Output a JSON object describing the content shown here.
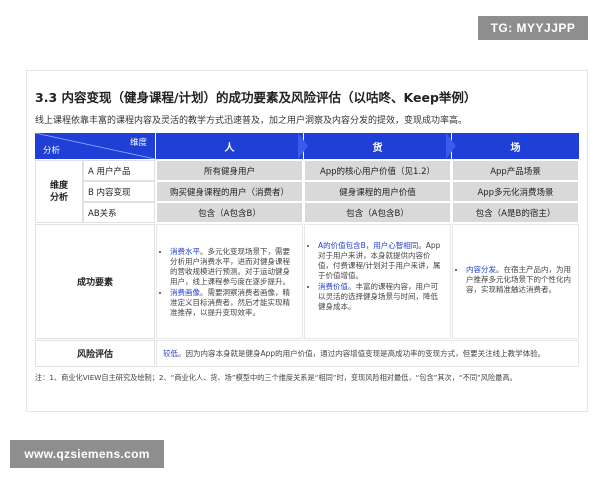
{
  "watermark_top": "TG: MYYJJPP",
  "watermark_bottom": "www.qzsiemens.com",
  "title": "3.3 内容变现（健身课程/计划）的成功要素及风险评估（以咕咚、Keep举例）",
  "subtitle": "线上课程依靠丰富的课程内容及灵活的教学方式迅速普及，加之用户洞察及内容分发的提效，变现成功率高。",
  "table": {
    "corner_top": "维度",
    "corner_bottom": "分析",
    "columns": [
      "人",
      "货",
      "场"
    ],
    "dim_label": "维度\n分析",
    "rows": [
      {
        "label": "A 用户产品",
        "cells": [
          "所有健身用户",
          "App的核心用户价值（见1.2）",
          "App产品场景"
        ]
      },
      {
        "label": "B 内容变现",
        "cells": [
          "购买健身课程的用户（消费者）",
          "健身课程的用户价值",
          "App多元化消费场景"
        ]
      },
      {
        "label": "AB关系",
        "cells": [
          "包含（A包含B）",
          "包含（A包含B）",
          "包含（A是B的宿主）"
        ]
      }
    ],
    "success_label": "成功要素",
    "success": {
      "ren": [
        {
          "key": "消费水平",
          "text": "。多元化变现场景下，需要分析用户消费水平，进而对健身课程的营收规模进行预测。对于运动健身用户，线上课程参与度在逐步提升。"
        },
        {
          "key": "消费画像",
          "text": "。需要洞察消费者画像，精准定义目标消费者，然后才能实现精准推荐，以提升变现效率。"
        }
      ],
      "huo": [
        {
          "key": "A的价值包含B，用户心智相同",
          "text": "。App对于用户来讲，本身就提供内容价值，付费课程/计划对于用户来讲，属于价值增值。"
        },
        {
          "key": "消费价值",
          "text": "。丰富的课程内容，用户可以灵活的选择健身场景与时间，降低健身成本。"
        }
      ],
      "chang": [
        {
          "key": "内容分发",
          "text": "。在宿主产品内，为用户推荐多元化场景下的个性化内容，实现精准触达消费者。"
        }
      ]
    },
    "risk_label": "风险评估",
    "risk_key": "较低",
    "risk_text": "。因为内容本身就是健身App的用户价值，通过内容增值变现是高成功率的变现方式，但要关注线上教学体验。"
  },
  "footnote": "注：1、商业化VIEW自主研究及绘制；2、“商业化人、货、场”模型中的三个维度关系是“相同”时，变现风险相对最低，“包含”其次，“不同”风险最高。",
  "colors": {
    "header_blue": "#1f3fd6",
    "cell_gray": "#d9d9d9",
    "link_blue": "#1f3fd6"
  }
}
